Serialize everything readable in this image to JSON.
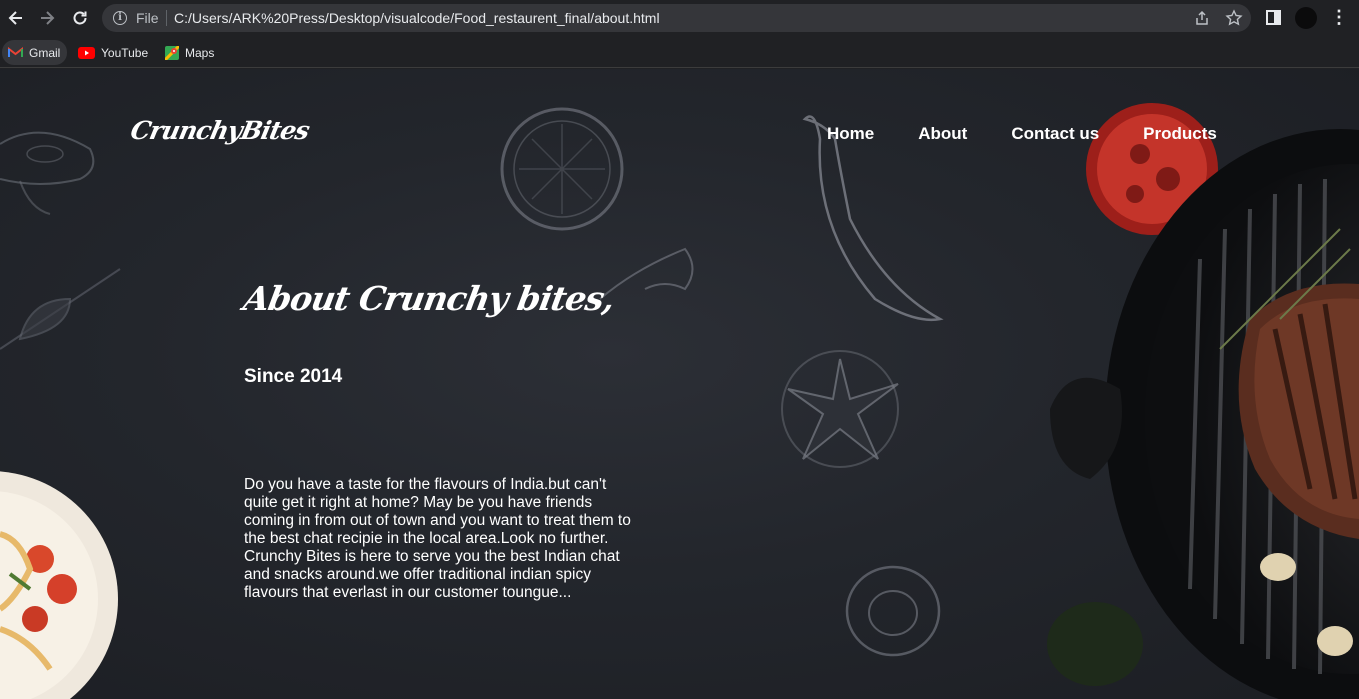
{
  "browser": {
    "file_label": "File",
    "url": "C:/Users/ARK%20Press/Desktop/visualcode/Food_restaurent_final/about.html",
    "icons": [
      "back-icon",
      "forward-icon",
      "reload-icon",
      "info-icon",
      "share-icon",
      "star-icon",
      "side-panel-icon",
      "profile-icon",
      "menu-icon"
    ],
    "bookmarks": [
      {
        "label": "Gmail",
        "icon": "gmail-icon"
      },
      {
        "label": "YouTube",
        "icon": "youtube-icon"
      },
      {
        "label": "Maps",
        "icon": "maps-icon"
      }
    ]
  },
  "site": {
    "logo": "CrunchyBites",
    "nav": [
      "Home",
      "About",
      "Contact us",
      "Products"
    ]
  },
  "about": {
    "heading": "About Crunchy bites,",
    "since": "Since 2014",
    "paragraph": "Do you have a taste for the flavours of India.but can't quite get it right at home? May be you have friends coming in from out of town and you want to treat them to the best chat recipie in the local area.Look no further. Crunchy Bites is here to serve you the best Indian chat and snacks around.we offer traditional indian spicy flavours that everlast in our customer toungue..."
  },
  "colors": {
    "chrome_bg": "#202124",
    "omnibox_bg": "#35363a",
    "page_bg": "#23262c",
    "text": "#ffffff"
  }
}
